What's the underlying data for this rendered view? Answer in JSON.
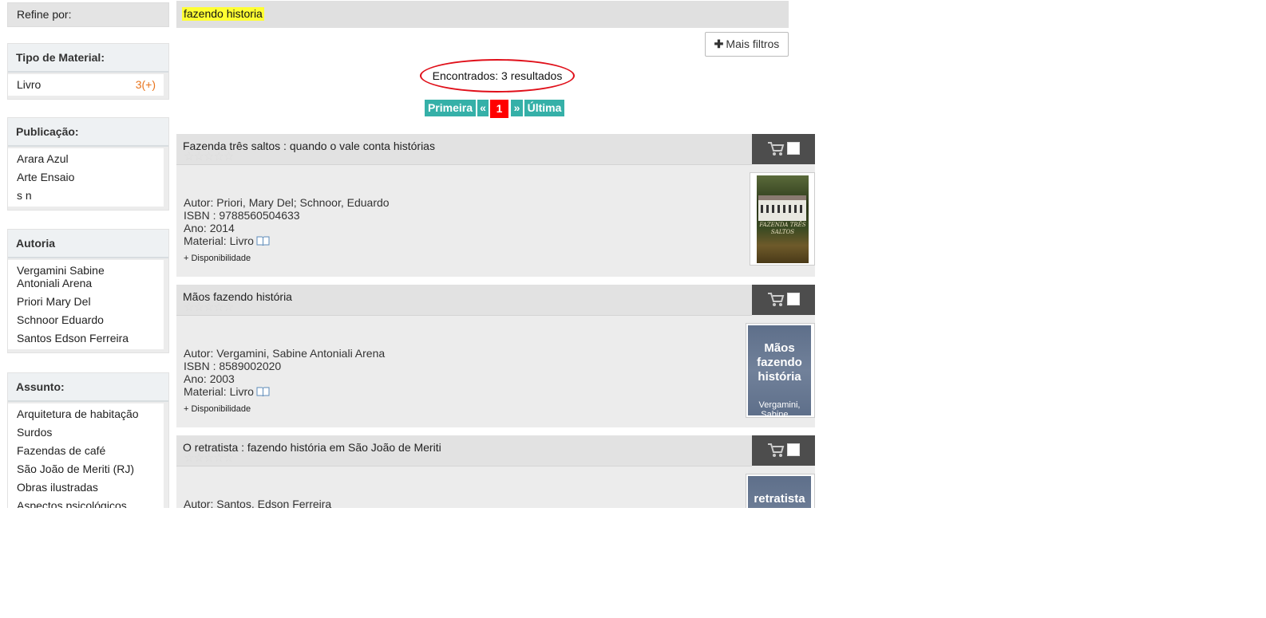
{
  "sidebar": {
    "refine_label": "Refine por:",
    "facets": [
      {
        "title": "Tipo de Material:",
        "items": [
          {
            "label": "Livro",
            "count": "3(+)"
          }
        ]
      },
      {
        "title": "Publicação:",
        "items": [
          {
            "label": "Arara Azul"
          },
          {
            "label": "Arte Ensaio"
          },
          {
            "label": "s n"
          }
        ]
      },
      {
        "title": "Autoria",
        "items": [
          {
            "label": "Vergamini Sabine Antoniali Arena"
          },
          {
            "label": "Priori Mary Del"
          },
          {
            "label": "Schnoor Eduardo"
          },
          {
            "label": "Santos Edson Ferreira"
          }
        ]
      },
      {
        "title": "Assunto:",
        "items": [
          {
            "label": "Arquitetura de habitação"
          },
          {
            "label": "Surdos"
          },
          {
            "label": "Fazendas de café"
          },
          {
            "label": "São João de Meriti (RJ)"
          },
          {
            "label": "Obras ilustradas"
          },
          {
            "label": "Aspectos psicológicos"
          }
        ]
      }
    ]
  },
  "search": {
    "term": "fazendo historia"
  },
  "filters": {
    "more_label": "Mais filtros"
  },
  "results_summary": "Encontrados: 3 resultados",
  "pager": {
    "first": "Primeira",
    "prev": "«",
    "current": "1",
    "next": "»",
    "last": "Última"
  },
  "results": [
    {
      "title": "Fazenda três saltos : quando o vale conta histórias",
      "author": "Autor: Priori, Mary Del; Schnoor, Eduardo",
      "isbn": "ISBN : 9788560504633",
      "year": "Ano: 2014",
      "material": "Material: Livro",
      "availability": "+ Disponibilidade",
      "cover_text": "FAZENDA TRÊS SALTOS"
    },
    {
      "title": "Mãos fazendo história",
      "author": "Autor: Vergamini, Sabine Antoniali Arena",
      "isbn": "ISBN : 8589002020",
      "year": "Ano: 2003",
      "material": "Material: Livro",
      "availability": "+ Disponibilidade",
      "cover_title": "Mãos fazendo história",
      "cover_author": "Vergamini, Sabine ..."
    },
    {
      "title": "O retratista : fazendo história em São João de Meriti",
      "author": "Autor: Santos, Edson Ferreira",
      "cover_title": "retratista"
    }
  ],
  "icons": {
    "cart": "cart-icon",
    "checkbox": "select-checkbox",
    "book": "book-icon",
    "rating": "star-rating",
    "plus": "plus-icon"
  },
  "colors": {
    "accent": "#35b0a8",
    "current_page": "#ff0000",
    "highlight": "#ffff33",
    "count": "#e8731b",
    "annotation": "#e0101a"
  }
}
